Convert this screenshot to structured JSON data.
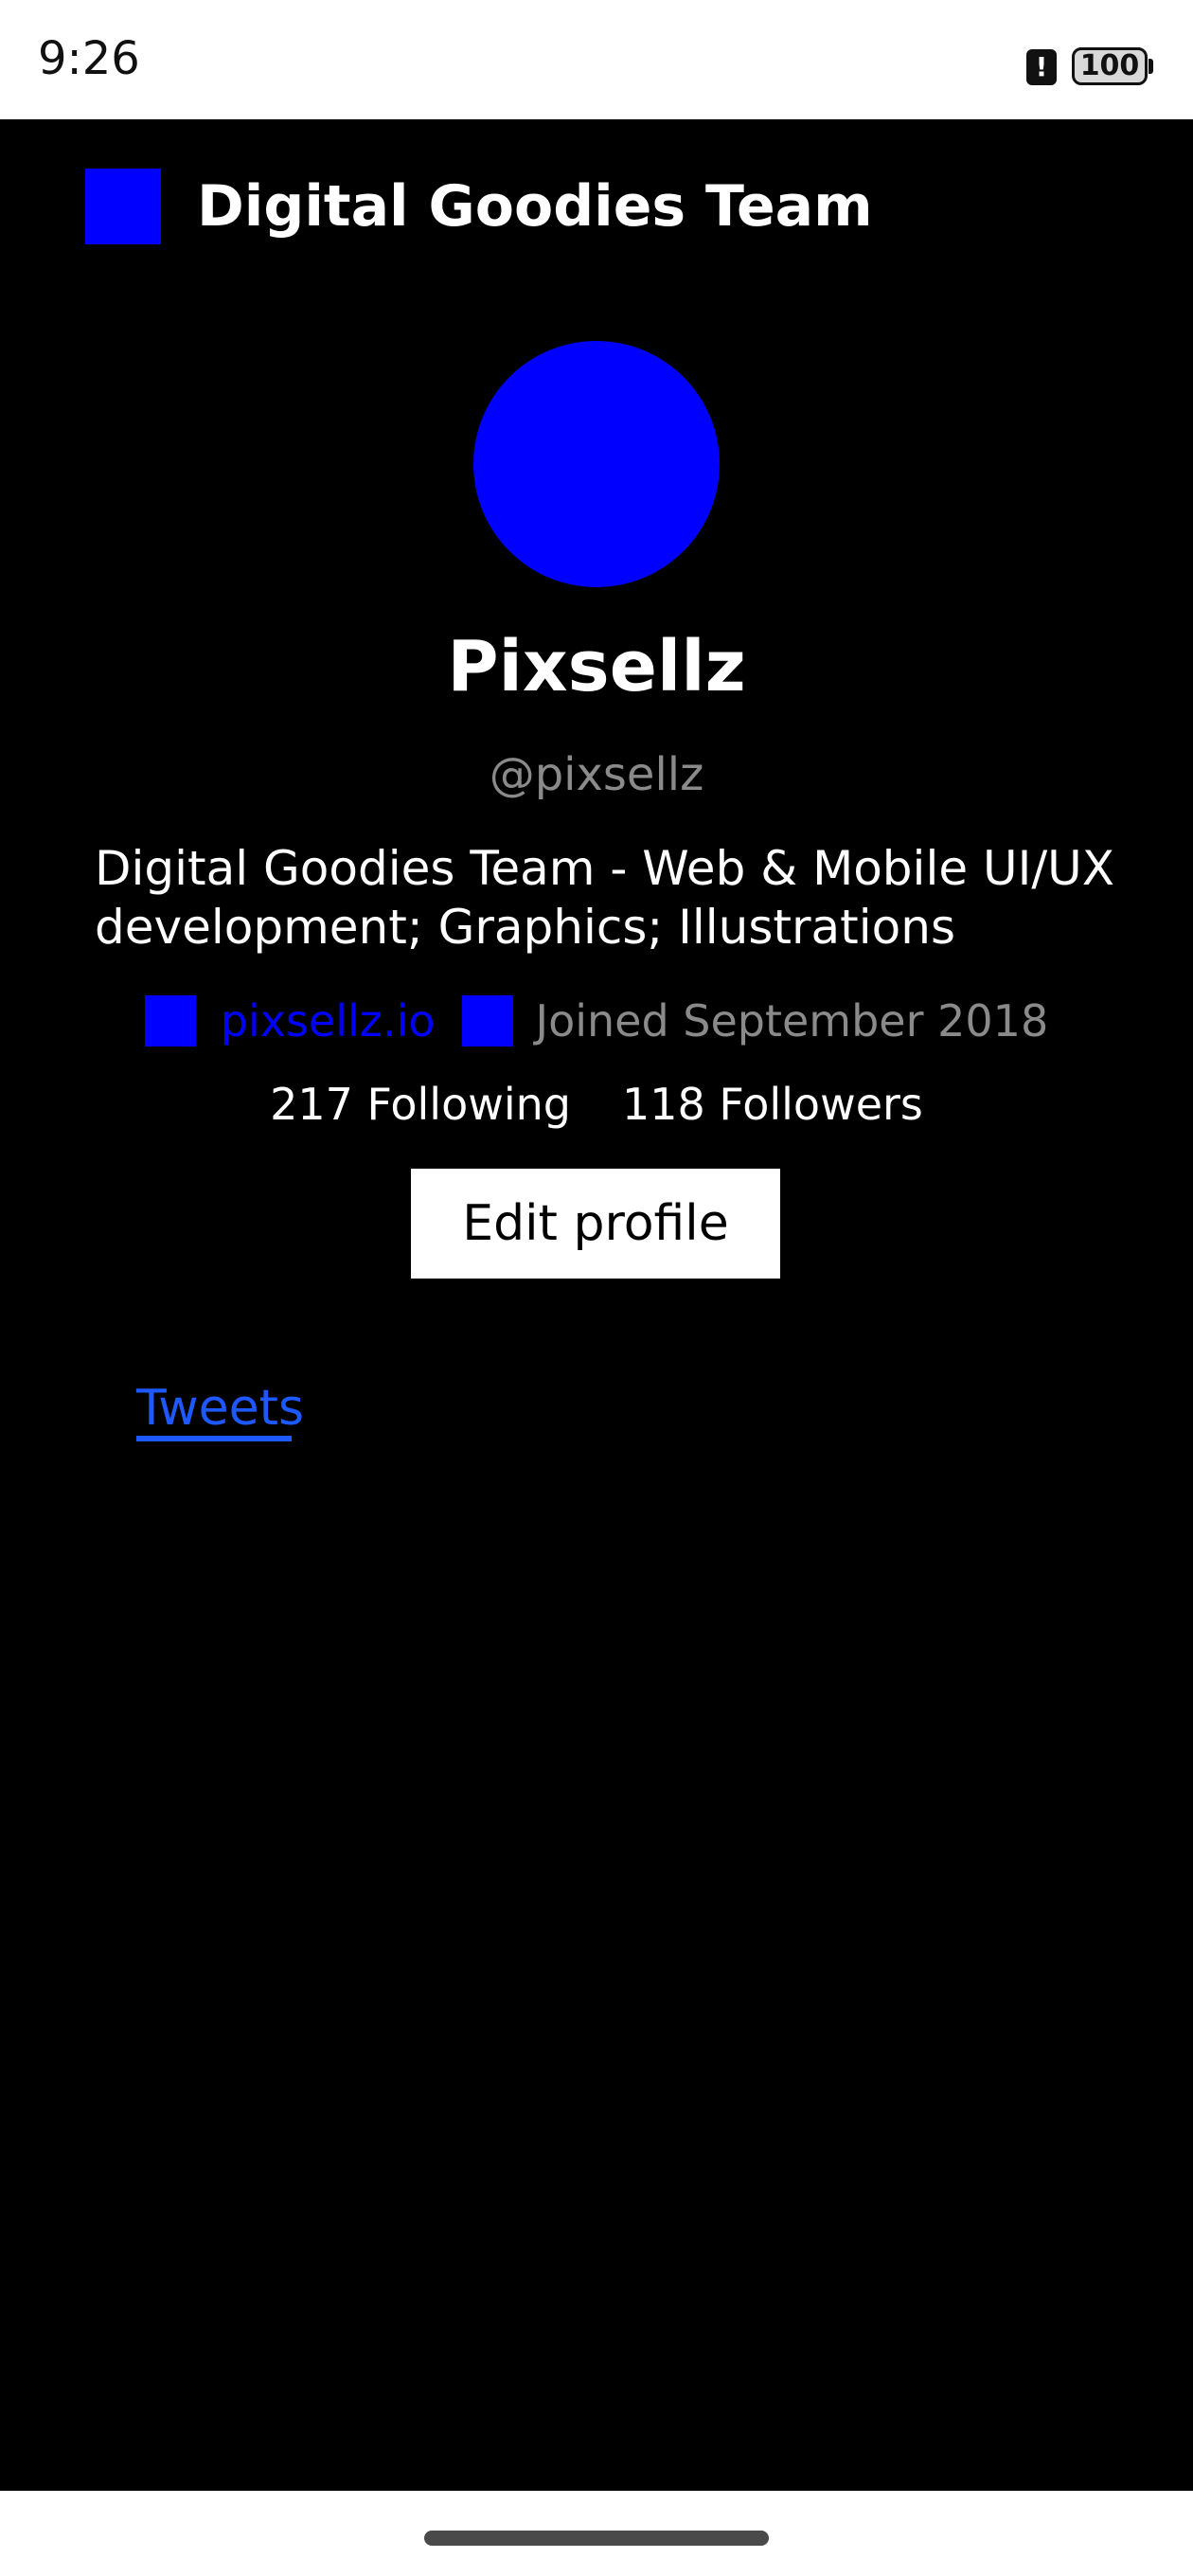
{
  "status_bar": {
    "time": "9:26",
    "alert_glyph": "!",
    "battery_level": "100"
  },
  "header": {
    "title": "Digital Goodies Team",
    "logo_icon": "square-logo-icon"
  },
  "profile": {
    "display_name": "Pixsellz",
    "handle": "@pixsellz",
    "bio": "Digital Goodies Team - Web & Mobile UI/UX development; Graphics; Illustrations",
    "website": "pixsellz.io",
    "joined": "Joined September 2018",
    "following": "217 Following",
    "followers": "118 Followers",
    "edit_button_label": "Edit profile"
  },
  "tabs": [
    {
      "label": "Tweets",
      "active": true
    }
  ],
  "colors": {
    "accent_blue": "#0000ff",
    "tab_blue": "#1d59ff",
    "background": "#000000",
    "muted_text": "#8a8a8a"
  }
}
